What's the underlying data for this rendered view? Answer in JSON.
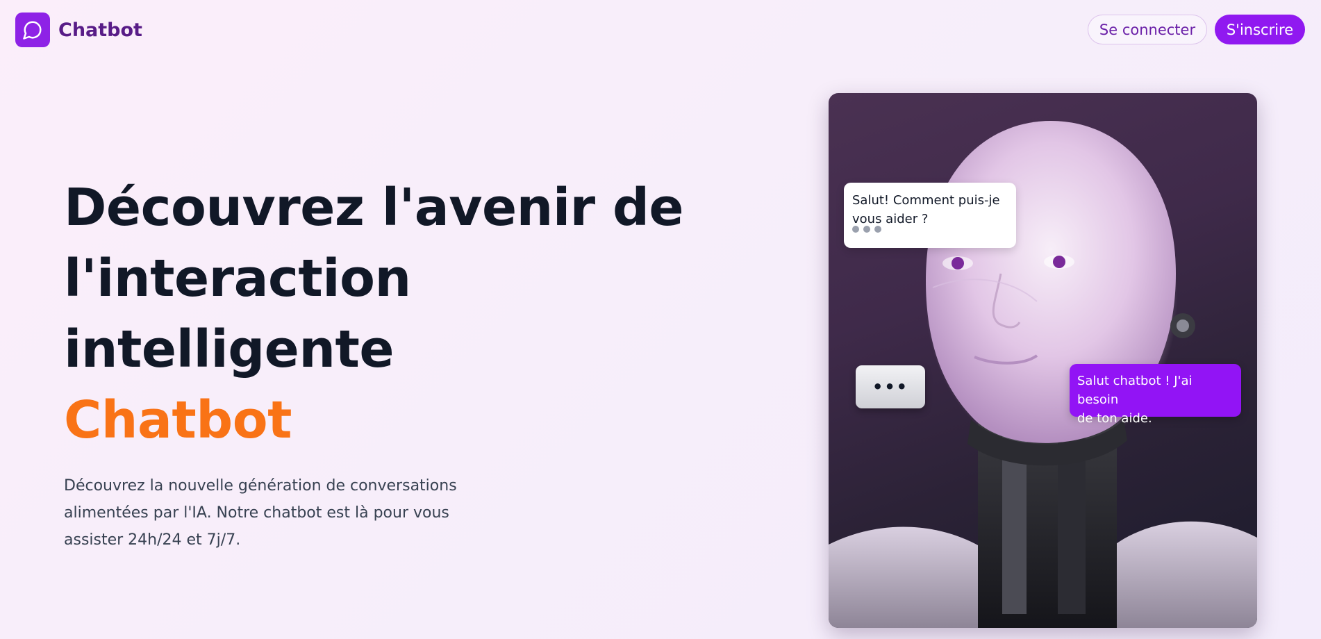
{
  "header": {
    "brand_name": "Chatbot",
    "logo_icon": "chat-bubble-icon",
    "login_label": "Se connecter",
    "signup_label": "S'inscrire"
  },
  "hero": {
    "title_line1": "Découvrez l'avenir de",
    "title_line2": "l'interaction",
    "title_line3": "intelligente",
    "title_accent": "Chatbot",
    "subtitle_line1": "Découvrez la nouvelle génération de conversations",
    "subtitle_line2": "alimentées par l'IA. Notre chatbot est là pour vous",
    "subtitle_line3": "assister 24h/24 et 7j/7."
  },
  "visual": {
    "bot_message_line1": "Salut! Comment puis-je",
    "bot_message_line2": "vous aider ?",
    "user_message_line1": "Salut chatbot ! J'ai besoin",
    "user_message_line2": "de ton aide.",
    "typing_indicator": "•••"
  },
  "colors": {
    "brand": "#8e22e6",
    "accent": "#f97316",
    "primary_button": "#9019f0",
    "user_bubble": "#9214f5"
  }
}
